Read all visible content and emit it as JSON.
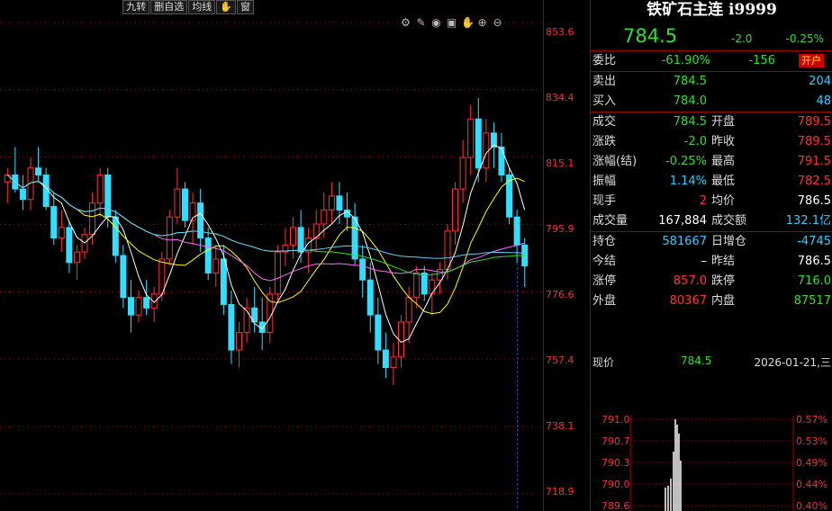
{
  "toolbar": {
    "buttons": [
      "九转",
      "删自选",
      "均线",
      "✋",
      "窗"
    ],
    "icons": [
      "settings-icon",
      "pen-icon",
      "eye-icon",
      "lock-icon",
      "hand-icon",
      "zoom-in-icon",
      "zoom-out-icon"
    ]
  },
  "axis": {
    "ticks": [
      "853.6",
      "834.4",
      "815.1",
      "795.9",
      "776.6",
      "757.4",
      "738.1",
      "718.9"
    ]
  },
  "colors": {
    "up": "#ff3333",
    "down": "#33ddff",
    "ma5": "#ffffff",
    "ma10": "#ffff00",
    "ma20": "#ff66ff",
    "ma40": "#33dd33",
    "ma60": "#66ccff",
    "grid": "#a00000"
  },
  "chart_data": {
    "type": "candlestick",
    "ylim": [
      714,
      860
    ],
    "candles": [
      [
        808,
        812,
        802,
        810
      ],
      [
        810,
        818,
        805,
        806
      ],
      [
        806,
        810,
        800,
        803
      ],
      [
        803,
        815,
        800,
        812
      ],
      [
        812,
        818,
        808,
        810
      ],
      [
        810,
        812,
        800,
        801
      ],
      [
        801,
        805,
        790,
        792
      ],
      [
        792,
        800,
        788,
        795
      ],
      [
        795,
        797,
        782,
        785
      ],
      [
        785,
        790,
        780,
        788
      ],
      [
        788,
        795,
        786,
        793
      ],
      [
        793,
        805,
        790,
        802
      ],
      [
        802,
        812,
        798,
        810
      ],
      [
        810,
        812,
        795,
        798
      ],
      [
        798,
        800,
        785,
        787
      ],
      [
        787,
        790,
        772,
        775
      ],
      [
        775,
        780,
        765,
        770
      ],
      [
        770,
        777,
        768,
        775
      ],
      [
        775,
        780,
        770,
        772
      ],
      [
        772,
        778,
        768,
        776
      ],
      [
        776,
        788,
        774,
        786
      ],
      [
        786,
        800,
        784,
        798
      ],
      [
        798,
        812,
        796,
        806
      ],
      [
        806,
        808,
        795,
        797
      ],
      [
        797,
        805,
        790,
        802
      ],
      [
        802,
        806,
        788,
        792
      ],
      [
        792,
        795,
        780,
        782
      ],
      [
        782,
        790,
        778,
        786
      ],
      [
        786,
        790,
        770,
        773
      ],
      [
        773,
        777,
        756,
        760
      ],
      [
        760,
        768,
        755,
        765
      ],
      [
        765,
        775,
        762,
        772
      ],
      [
        772,
        778,
        765,
        768
      ],
      [
        768,
        775,
        760,
        765
      ],
      [
        765,
        778,
        762,
        776
      ],
      [
        776,
        790,
        774,
        788
      ],
      [
        788,
        795,
        784,
        790
      ],
      [
        790,
        798,
        786,
        795
      ],
      [
        795,
        800,
        785,
        788
      ],
      [
        788,
        795,
        782,
        792
      ],
      [
        792,
        800,
        788,
        796
      ],
      [
        796,
        805,
        792,
        800
      ],
      [
        800,
        808,
        796,
        804
      ],
      [
        804,
        808,
        796,
        800
      ],
      [
        800,
        805,
        794,
        798
      ],
      [
        798,
        802,
        784,
        786
      ],
      [
        786,
        790,
        775,
        780
      ],
      [
        780,
        785,
        765,
        770
      ],
      [
        770,
        775,
        756,
        760
      ],
      [
        760,
        765,
        752,
        755
      ],
      [
        755,
        762,
        750,
        758
      ],
      [
        758,
        770,
        755,
        768
      ],
      [
        768,
        778,
        762,
        775
      ],
      [
        775,
        784,
        772,
        782
      ],
      [
        782,
        784,
        774,
        776
      ],
      [
        776,
        782,
        770,
        780
      ],
      [
        780,
        785,
        776,
        783
      ],
      [
        783,
        796,
        780,
        794
      ],
      [
        794,
        808,
        790,
        806
      ],
      [
        806,
        820,
        802,
        815
      ],
      [
        815,
        830,
        810,
        826
      ],
      [
        826,
        832,
        808,
        812
      ],
      [
        812,
        826,
        808,
        822
      ],
      [
        822,
        825,
        812,
        818
      ],
      [
        818,
        822,
        808,
        810
      ],
      [
        810,
        812,
        796,
        798
      ],
      [
        798,
        800,
        785,
        790
      ],
      [
        790,
        792,
        778,
        784
      ]
    ]
  },
  "quote": {
    "title": "铁矿石主连 i9999",
    "price": "784.5",
    "change": "-2.0",
    "change_pct": "-0.25%",
    "row_weibi": {
      "label": "委比",
      "v1": "-61.90%",
      "v2": "-156",
      "badge": "开户"
    },
    "row_sell": {
      "label": "卖出",
      "v1": "784.5",
      "v2": "204"
    },
    "row_buy": {
      "label": "买入",
      "v1": "784.0",
      "v2": "48"
    },
    "rows": [
      {
        "l1": "成交",
        "v1": "784.5",
        "l2": "开盘",
        "v2": "789.5"
      },
      {
        "l1": "涨跌",
        "v1": "-2.0",
        "l2": "昨收",
        "v2": "789.5"
      },
      {
        "l1": "涨幅(结)",
        "v1": "-0.25%",
        "l2": "最高",
        "v2": "791.5"
      },
      {
        "l1": "振幅",
        "v1": "1.14%",
        "l2": "最低",
        "v2": "782.5"
      },
      {
        "l1": "现手",
        "v1": "2",
        "l2": "均价",
        "v2": "786.5"
      },
      {
        "l1": "成交量",
        "v1": "167,884",
        "l2": "成交额",
        "v2": "132.1亿"
      }
    ],
    "rows2": [
      {
        "l1": "持仓",
        "v1": "581667",
        "l2": "日增仓",
        "v2": "-4745"
      },
      {
        "l1": "今结",
        "v1": "–",
        "l2": "昨结",
        "v2": "786.5"
      },
      {
        "l1": "涨停",
        "v1": "857.0",
        "l2": "跌停",
        "v2": "716.0"
      },
      {
        "l1": "外盘",
        "v1": "80367",
        "l2": "内盘",
        "v2": "87517"
      }
    ],
    "now": {
      "label": "现价",
      "price": "784.5",
      "date": "2026-01-21,三"
    },
    "mini_left": [
      "791.0",
      "790.7",
      "790.3",
      "790.0",
      "789.6"
    ],
    "mini_right": [
      "0.57%",
      "0.53%",
      "0.49%",
      "0.44%",
      "0.40%"
    ]
  }
}
